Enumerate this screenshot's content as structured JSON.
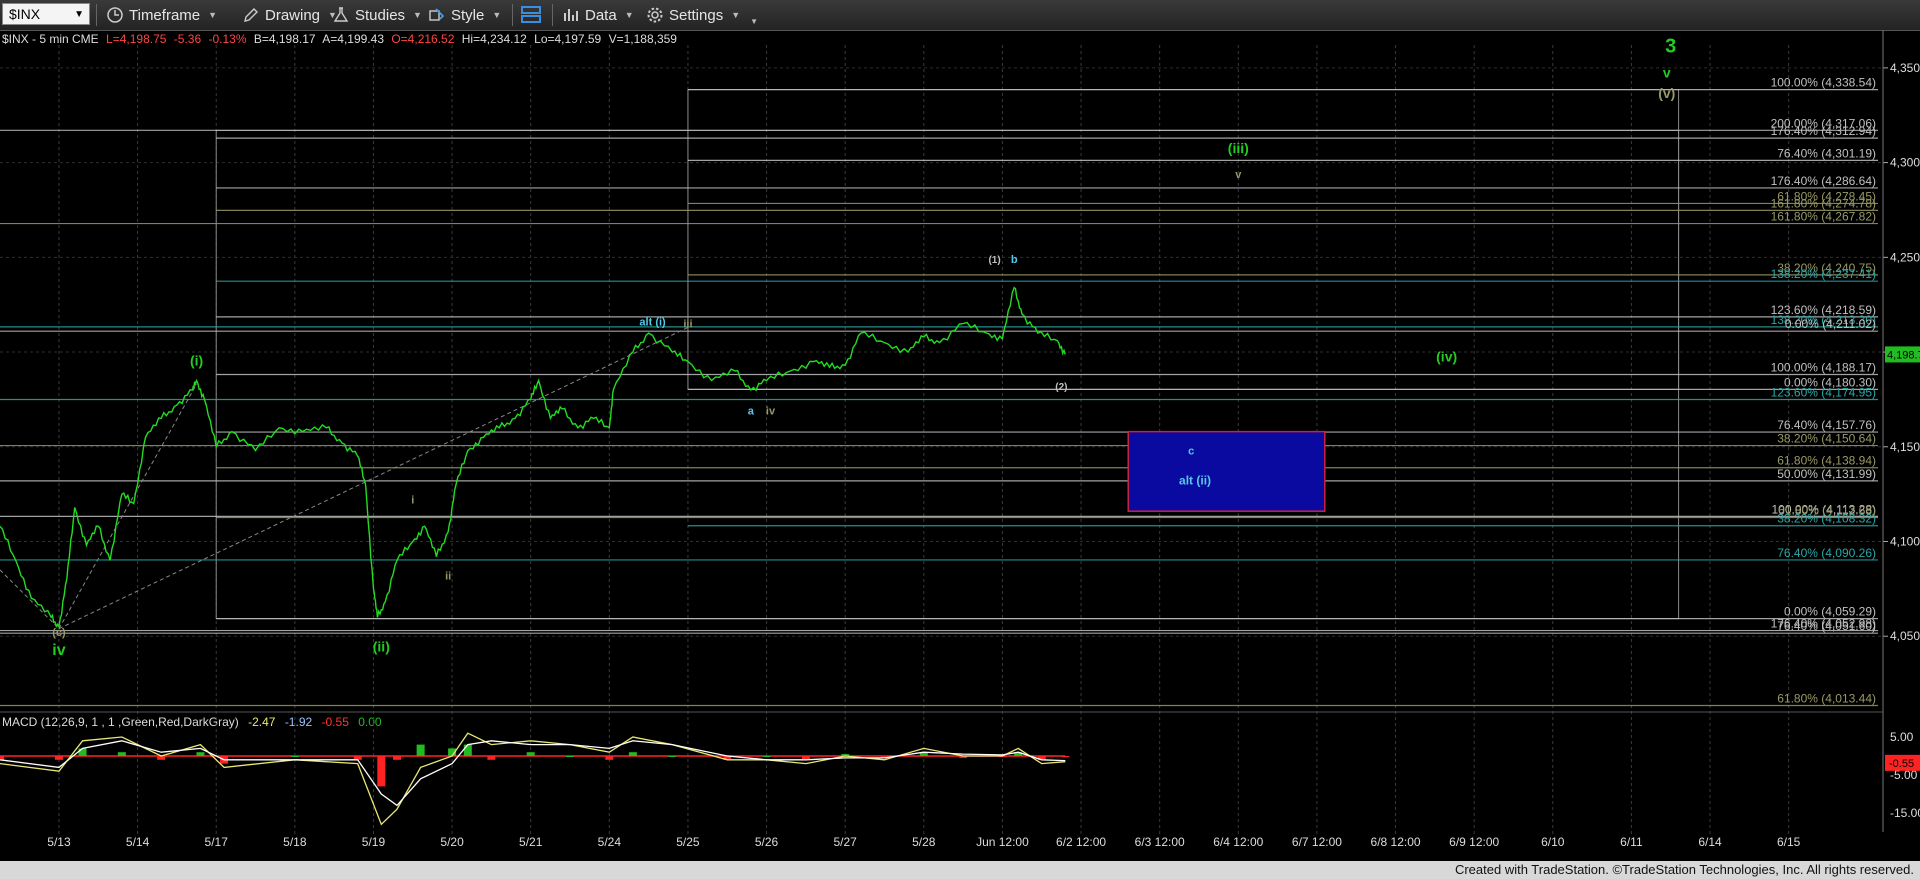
{
  "toolbar": {
    "symbol": "$INX",
    "timeframe": "Timeframe",
    "drawing": "Drawing",
    "studies": "Studies",
    "style": "Style",
    "data": "Data",
    "settings": "Settings"
  },
  "header_info": {
    "symbol_interval": "$INX - 5 min CME",
    "last": "L=4,198.75",
    "net_change": "-5.36",
    "pct_change": "-0.13%",
    "bid": "B=4,198.17",
    "ask": "A=4,199.43",
    "open": "O=4,216.52",
    "high": "Hi=4,234.12",
    "low": "Lo=4,197.59",
    "volume": "V=1,188,359"
  },
  "colors": {
    "price": "#22dd22",
    "fib_gray": "#c0c0c0",
    "fib_olive": "#999966",
    "fib_teal": "#2aa7a7",
    "wave_green": "#22cc22",
    "wave_cyan": "#55c8e8",
    "last_price_bg": "#22bb22",
    "macd_negative": "#ff2222",
    "box_fill": "#0a0aa0",
    "box_border": "#cc2244"
  },
  "price_axis": {
    "labels": [
      "4,350.00",
      "4,300.00",
      "4,250.00",
      "4,200.00",
      "4,150.00",
      "4,100.00",
      "4,050.00"
    ],
    "values": [
      4350,
      4300,
      4250,
      4200,
      4150,
      4100,
      4050
    ],
    "last_price_label": "4,198.75",
    "last_price": 4198.75
  },
  "time_axis": [
    {
      "label": "5/13",
      "x": 0
    },
    {
      "label": "5/14",
      "x": 1
    },
    {
      "label": "5/17",
      "x": 2
    },
    {
      "label": "5/18",
      "x": 3
    },
    {
      "label": "5/19",
      "x": 4
    },
    {
      "label": "5/20",
      "x": 5
    },
    {
      "label": "5/21",
      "x": 6
    },
    {
      "label": "5/24",
      "x": 7
    },
    {
      "label": "5/25",
      "x": 8
    },
    {
      "label": "5/26",
      "x": 9
    },
    {
      "label": "5/27",
      "x": 10
    },
    {
      "label": "5/28",
      "x": 11
    },
    {
      "label": "Jun 12:00",
      "x": 12
    },
    {
      "label": "6/2 12:00",
      "x": 13
    },
    {
      "label": "6/3 12:00",
      "x": 14
    },
    {
      "label": "6/4 12:00",
      "x": 15
    },
    {
      "label": "6/7 12:00",
      "x": 16
    },
    {
      "label": "6/8 12:00",
      "x": 17
    },
    {
      "label": "6/9 12:00",
      "x": 18
    },
    {
      "label": "6/10",
      "x": 19
    },
    {
      "label": "6/11",
      "x": 20
    },
    {
      "label": "6/14",
      "x": 21
    },
    {
      "label": "6/15",
      "x": 22
    }
  ],
  "chart_data": [
    {
      "type": "line",
      "title": "$INX - 5 min CME",
      "x_unit": "trading session index (0 = 5/13)",
      "ylim": [
        4010,
        4370
      ],
      "xlim": [
        -0.75,
        23.2
      ],
      "series": [
        {
          "x": [
            -0.75,
            -0.55,
            -0.35,
            -0.1,
            0.0,
            0.1,
            0.2,
            0.35,
            0.5,
            0.65,
            0.8,
            0.95,
            1.1,
            1.3,
            1.5,
            1.7,
            1.75,
            1.85,
            2.0,
            2.2,
            2.5,
            2.8,
            3.1,
            3.4,
            3.6,
            3.8,
            3.9,
            4.0,
            4.05,
            4.15,
            4.3,
            4.5,
            4.65,
            4.8,
            4.95,
            5.05,
            5.2,
            5.4,
            5.6,
            5.8,
            6.0,
            6.1,
            6.25,
            6.4,
            6.6,
            6.8,
            7.0,
            7.05,
            7.3,
            7.5,
            7.8,
            8.0,
            8.3,
            8.6,
            8.8,
            9.0,
            9.3,
            9.6,
            9.8,
            10.0,
            10.2,
            10.5,
            10.8,
            11.0,
            11.2,
            11.5,
            11.8,
            12.0,
            12.15,
            12.25,
            12.45,
            12.7,
            12.8
          ],
          "y": [
            4108,
            4090,
            4070,
            4060,
            4055,
            4080,
            4118,
            4098,
            4108,
            4090,
            4125,
            4120,
            4155,
            4165,
            4172,
            4180,
            4185,
            4175,
            4150,
            4158,
            4148,
            4160,
            4158,
            4160,
            4152,
            4145,
            4130,
            4075,
            4060,
            4068,
            4090,
            4100,
            4108,
            4092,
            4105,
            4130,
            4148,
            4155,
            4160,
            4165,
            4175,
            4185,
            4165,
            4170,
            4160,
            4165,
            4160,
            4180,
            4200,
            4210,
            4200,
            4195,
            4185,
            4190,
            4180,
            4185,
            4190,
            4195,
            4192,
            4193,
            4210,
            4205,
            4200,
            4208,
            4205,
            4215,
            4210,
            4207,
            4234,
            4220,
            4210,
            4206,
            4198.75
          ]
        }
      ]
    },
    {
      "type": "line",
      "title": "MACD (12,26,9, 1 , 1 ,Green,Red,DarkGray)",
      "ylim": [
        -20,
        10
      ],
      "yticks": [
        5,
        -5,
        -15
      ],
      "ytick_labels": [
        "5.00",
        "-5.00",
        "-15.00"
      ],
      "current_values": [
        "-2.47",
        "-1.92",
        "-0.55",
        "0.00"
      ],
      "hist_label": "-0.55",
      "series": [
        {
          "x": [
            -0.75,
            0,
            0.3,
            0.8,
            1.3,
            1.8,
            2.1,
            3,
            3.8,
            4.1,
            4.3,
            4.6,
            5,
            5.2,
            5.5,
            6,
            6.5,
            7,
            7.3,
            7.8,
            8.5,
            9,
            9.5,
            10,
            10.5,
            11,
            11.5,
            12,
            12.2,
            12.5,
            12.8
          ],
          "y": [
            -2,
            -4,
            4,
            5,
            0,
            3,
            -3,
            -1,
            -2,
            -18,
            -14,
            -3,
            0,
            6,
            3,
            4,
            3,
            1,
            5,
            3,
            -1,
            -1,
            -2,
            0,
            -1,
            2,
            0,
            0,
            2,
            -2,
            -1.5
          ]
        },
        {
          "x": [
            -0.75,
            0,
            0.3,
            0.8,
            1.3,
            1.8,
            2.1,
            3,
            3.8,
            4.1,
            4.3,
            4.6,
            5,
            5.2,
            5.5,
            6,
            6.5,
            7,
            7.3,
            7.8,
            8.5,
            9,
            9.5,
            10,
            10.5,
            11,
            11.5,
            12,
            12.2,
            12.5,
            12.8
          ],
          "y": [
            -1,
            -3,
            2,
            4,
            1,
            2,
            -1,
            -1,
            -1,
            -10,
            -13,
            -6,
            -2,
            3,
            4,
            3,
            3,
            2,
            4,
            3,
            0,
            -1,
            -1,
            -0.5,
            -0.5,
            1,
            0.5,
            0.3,
            1,
            -1,
            -1.2
          ]
        }
      ]
    }
  ],
  "fib_levels": [
    {
      "label": "100.00% (4,338.54)",
      "price": 4338.54,
      "color": "gray",
      "x_start": 8
    },
    {
      "label": "200.00% (4,317.06)",
      "price": 4317.06,
      "color": "gray",
      "x_start": -0.75
    },
    {
      "label": "176.40% (4,312.94)",
      "price": 4312.94,
      "color": "gray",
      "x_start": 2
    },
    {
      "label": "76.40% (4,301.19)",
      "price": 4301.19,
      "color": "gray",
      "x_start": 8
    },
    {
      "label": "176.40% (4,286.64)",
      "price": 4286.64,
      "color": "gray",
      "x_start": 2
    },
    {
      "label": "61.80% (4,278.45)",
      "price": 4278.45,
      "color": "olive",
      "x_start": 8
    },
    {
      "label": "161.80% (4,274.78)",
      "price": 4274.78,
      "color": "olive",
      "x_start": 2
    },
    {
      "label": "161.80% (4,267.82)",
      "price": 4267.82,
      "color": "olive",
      "x_start": -0.75
    },
    {
      "label": "38.20% (4,240.75)",
      "price": 4240.75,
      "color": "olive",
      "x_start": 8
    },
    {
      "label": "138.20% (4,237.41)",
      "price": 4237.41,
      "color": "teal",
      "x_start": 2
    },
    {
      "label": "123.60% (4,218.59)",
      "price": 4218.59,
      "color": "gray",
      "x_start": 2
    },
    {
      "label": "138.20% (4,213.30)",
      "price": 4213.3,
      "color": "teal",
      "x_start": -0.75
    },
    {
      "label": "0.00% (4,211.02)",
      "price": 4211.02,
      "color": "gray",
      "x_start": -0.75
    },
    {
      "label": "100.00% (4,188.17)",
      "price": 4188.17,
      "color": "gray",
      "x_start": 2
    },
    {
      "label": "0.00% (4,180.30)",
      "price": 4180.3,
      "color": "gray",
      "x_start": 8
    },
    {
      "label": "123.60% (4,174.95)",
      "price": 4174.95,
      "color": "teal",
      "x_start": -0.75
    },
    {
      "label": "76.40% (4,157.76)",
      "price": 4157.76,
      "color": "gray",
      "x_start": 2
    },
    {
      "label": "38.20% (4,150.64)",
      "price": 4150.64,
      "color": "olive",
      "x_start": -0.75
    },
    {
      "label": "61.80% (4,138.94)",
      "price": 4138.94,
      "color": "olive",
      "x_start": 2
    },
    {
      "label": "50.00% (4,131.99)",
      "price": 4131.99,
      "color": "gray",
      "x_start": -0.75
    },
    {
      "label": "100.00% (4,113.28)",
      "price": 4113.28,
      "color": "gray",
      "x_start": -0.75
    },
    {
      "label": "61.80% (4,112.68)",
      "price": 4112.68,
      "color": "olive",
      "x_start": 2
    },
    {
      "label": "38.20% (4,108.32)",
      "price": 4108.32,
      "color": "teal",
      "x_start": 8
    },
    {
      "label": "76.40% (4,090.26)",
      "price": 4090.26,
      "color": "teal",
      "x_start": -0.75
    },
    {
      "label": "0.00% (4,059.29)",
      "price": 4059.29,
      "color": "gray",
      "x_start": 2
    },
    {
      "label": "176.40% (4,052.98)",
      "price": 4052.98,
      "color": "gray",
      "x_start": -0.75
    },
    {
      "label": "76.40% (4,051.60)",
      "price": 4051.6,
      "color": "gray",
      "x_start": -0.75
    },
    {
      "label": "61.80% (4,013.44)",
      "price": 4013.44,
      "color": "olive",
      "x_start": -0.75
    }
  ],
  "wave_labels": [
    {
      "text": "3",
      "x": 20.5,
      "y": 4358,
      "color": "green",
      "size": 20
    },
    {
      "text": "v",
      "x": 20.45,
      "y": 4345,
      "color": "green",
      "size": 14
    },
    {
      "text": "(v)",
      "x": 20.45,
      "y": 4334,
      "color": "olive",
      "size": 14
    },
    {
      "text": "(iii)",
      "x": 15.0,
      "y": 4305,
      "color": "green",
      "size": 14
    },
    {
      "text": "v",
      "x": 15.0,
      "y": 4292,
      "color": "olive",
      "size": 11
    },
    {
      "text": "(1)",
      "x": 11.9,
      "y": 4247,
      "color": "gray",
      "size": 10
    },
    {
      "text": "b",
      "x": 12.15,
      "y": 4247,
      "color": "cyan",
      "size": 11
    },
    {
      "text": "alt (i)",
      "x": 7.55,
      "y": 4214,
      "color": "cyan",
      "size": 11
    },
    {
      "text": "iii",
      "x": 8.0,
      "y": 4213,
      "color": "olive",
      "size": 11
    },
    {
      "text": "(iv)",
      "x": 17.65,
      "y": 4195,
      "color": "green",
      "size": 14
    },
    {
      "text": "(i)",
      "x": 1.75,
      "y": 4193,
      "color": "green",
      "size": 14
    },
    {
      "text": "(2)",
      "x": 12.75,
      "y": 4180,
      "color": "gray",
      "size": 10
    },
    {
      "text": "a",
      "x": 8.8,
      "y": 4167,
      "color": "cyan",
      "size": 11
    },
    {
      "text": "iv",
      "x": 9.05,
      "y": 4167,
      "color": "olive",
      "size": 11
    },
    {
      "text": "c",
      "x": 14.4,
      "y": 4146,
      "color": "cyan",
      "size": 11
    },
    {
      "text": "alt (ii)",
      "x": 14.45,
      "y": 4130,
      "color": "cyan",
      "size": 12
    },
    {
      "text": "i",
      "x": 4.5,
      "y": 4120,
      "color": "olive",
      "size": 11
    },
    {
      "text": "ii",
      "x": 4.95,
      "y": 4080,
      "color": "olive",
      "size": 11
    },
    {
      "text": "(c)",
      "x": 0.0,
      "y": 4050,
      "color": "olive",
      "size": 11
    },
    {
      "text": "(ii)",
      "x": 4.1,
      "y": 4042,
      "color": "green",
      "size": 14
    },
    {
      "text": "iv",
      "x": 0.0,
      "y": 4040,
      "color": "green",
      "size": 16
    }
  ],
  "target_box": {
    "x1": 13.6,
    "x2": 16.1,
    "y1": 4158,
    "y2": 4116
  },
  "footer": "Created with TradeStation. ©TradeStation Technologies, Inc. All rights reserved."
}
